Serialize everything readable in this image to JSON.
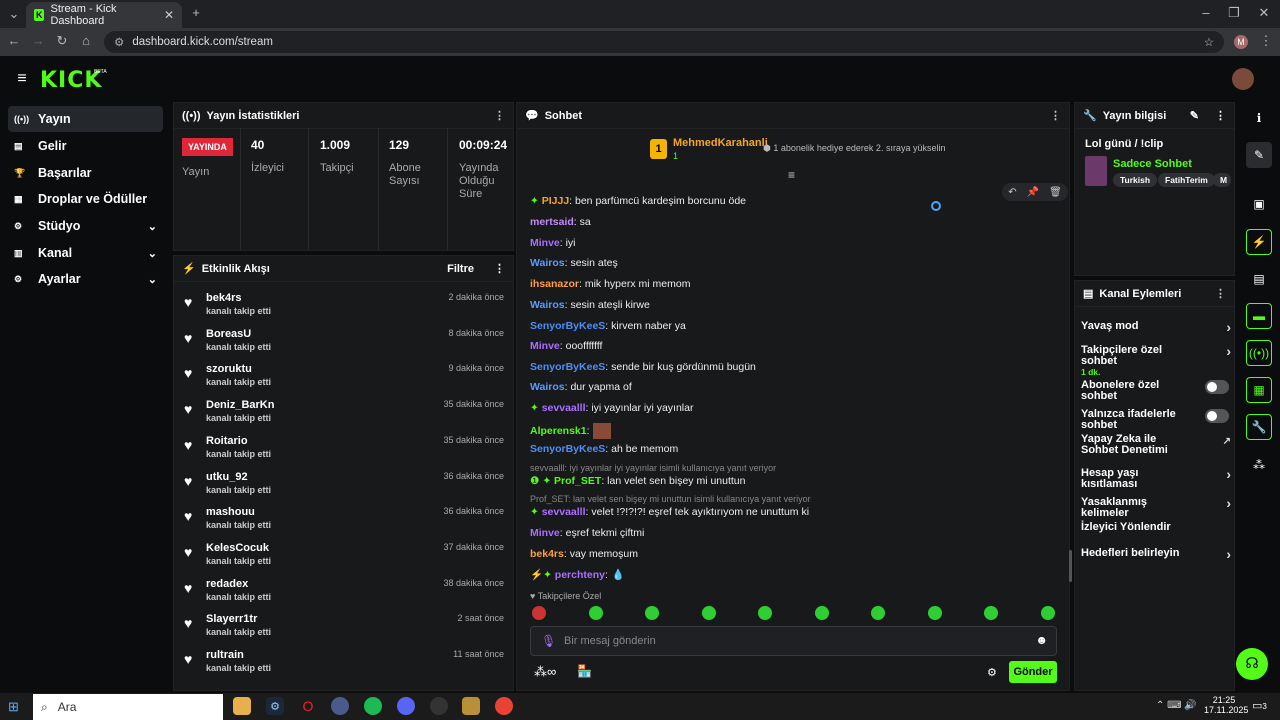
{
  "browser": {
    "tab_title": "Stream - Kick Dashboard",
    "url": "dashboard.kick.com/stream",
    "profile_initial": "M"
  },
  "app": {
    "logo": "KICK",
    "beta": "BETA"
  },
  "sidebar": {
    "items": [
      {
        "label": "Yayın",
        "icon": "stream-icon"
      },
      {
        "label": "Gelir",
        "icon": "income-icon"
      },
      {
        "label": "Başarılar",
        "icon": "trophy-icon"
      },
      {
        "label": "Droplar ve Ödüller",
        "icon": "gift-icon"
      },
      {
        "label": "Stüdyo",
        "icon": "gear-icon"
      },
      {
        "label": "Kanal",
        "icon": "channel-icon"
      },
      {
        "label": "Ayarlar",
        "icon": "settings-icon"
      }
    ]
  },
  "stats": {
    "title": "Yayın İstatistikleri",
    "live_badge": "YAYINDA",
    "live_label": "Yayın",
    "viewers": "40",
    "viewers_label": "İzleyici",
    "followers": "1.009",
    "followers_label": "Takipçi",
    "subs": "129",
    "subs_label": "Abone Sayısı",
    "uptime": "00:09:24",
    "uptime_label": "Yayında Olduğu Süre"
  },
  "activity": {
    "title": "Etkinlik Akışı",
    "filter": "Filtre",
    "events": [
      {
        "name": "bek4rs",
        "sub": "kanalı takip etti",
        "time": "2 dakika önce"
      },
      {
        "name": "BoreasU",
        "sub": "kanalı takip etti",
        "time": "8 dakika önce"
      },
      {
        "name": "szoruktu",
        "sub": "kanalı takip etti",
        "time": "9 dakika önce"
      },
      {
        "name": "Deniz_BarKn",
        "sub": "kanalı takip etti",
        "time": "35 dakika önce"
      },
      {
        "name": "Roitario",
        "sub": "kanalı takip etti",
        "time": "35 dakika önce"
      },
      {
        "name": "utku_92",
        "sub": "kanalı takip etti",
        "time": "36 dakika önce"
      },
      {
        "name": "mashouu",
        "sub": "kanalı takip etti",
        "time": "36 dakika önce"
      },
      {
        "name": "KelesCocuk",
        "sub": "kanalı takip etti",
        "time": "37 dakika önce"
      },
      {
        "name": "redadex",
        "sub": "kanalı takip etti",
        "time": "38 dakika önce"
      },
      {
        "name": "Slayerr1tr",
        "sub": "kanalı takip etti",
        "time": "2 saat önce"
      },
      {
        "name": "rultrain",
        "sub": "kanalı takip etti",
        "time": "11 saat önce"
      }
    ]
  },
  "chat": {
    "title": "Sohbet",
    "pinned_user": "MehmedKarahanli",
    "pinned_count": "1",
    "pinned_rank": "1",
    "gift_text": "1 abonelik hediye ederek 2. sıraya yükselin",
    "messages": [
      {
        "user": "PIJJJ",
        "color": "#f5a623",
        "text": ": ben parfümcü kardeşim borcunu öde"
      },
      {
        "user": "mertsaid",
        "color": "#c58af9",
        "text": ": sa"
      },
      {
        "user": "Minve",
        "color": "#a970ff",
        "text": ": iyi"
      },
      {
        "user": "Wairos",
        "color": "#5b9bff",
        "text": ": sesin ateş"
      },
      {
        "user": "ihsanazor",
        "color": "#ff9f43",
        "text": ": mik hyperx mi memom"
      },
      {
        "user": "Wairos",
        "color": "#5b9bff",
        "text": ": sesin ateşli kirwe"
      },
      {
        "user": "SenyorByKeeS",
        "color": "#4d8ef7",
        "text": ": kirvem naber ya"
      },
      {
        "user": "Minve",
        "color": "#a970ff",
        "text": ": ooofffffff"
      },
      {
        "user": "SenyorByKeeS",
        "color": "#4d8ef7",
        "text": ": sende bir kuş gördünmü bugün"
      },
      {
        "user": "Wairos",
        "color": "#5b9bff",
        "text": ": dur yapma of"
      },
      {
        "user": "sevvaalll",
        "color": "#a970ff",
        "text": ": iyi yayınlar iyi yayınlar"
      },
      {
        "user": "Alperensk1",
        "color": "#53fc18",
        "text": ":"
      },
      {
        "user": "SenyorByKeeS",
        "color": "#4d8ef7",
        "text": ": ah be memom"
      },
      {
        "user": "Prof_SET",
        "color": "#53fc18",
        "text": ": lan velet sen bişey mi unuttun"
      },
      {
        "user": "sevvaalll",
        "color": "#a970ff",
        "text": ": velet !?!?!?! eşref tek ayıktırıyom ne unuttum ki"
      },
      {
        "user": "Minve",
        "color": "#a970ff",
        "text": ": eşref tekmi çiftmi"
      },
      {
        "user": "bek4rs",
        "color": "#ff9f43",
        "text": ": vay memoşum"
      },
      {
        "user": "perchteny",
        "color": "#a970ff",
        "text": ":"
      }
    ],
    "reply1": "sevvaalll: iyi yayınlar iyi yayınlar isimli kullanıcıya yanıt veriyor",
    "reply2": "Prof_SET: lan velet sen bişey mi unuttun isimli kullanıcıya yanıt veriyor",
    "followers_only": "Takipçilere Özel",
    "placeholder": "Bir mesaj gönderin",
    "send": "Gönder"
  },
  "stream_info": {
    "title": "Yayın bilgisi",
    "stream_title": "Lol günü / !clip",
    "category": "Sadece Sohbet",
    "tags": [
      "Turkish",
      "FatihTerim",
      "M"
    ]
  },
  "channel_actions": {
    "title": "Kanal Eylemleri",
    "items": [
      {
        "label": "Yavaş mod",
        "type": "chev"
      },
      {
        "label": "Takipçilere özel sohbet",
        "sub": "1 dk.",
        "type": "chev"
      },
      {
        "label": "Abonelere özel sohbet",
        "type": "toggle"
      },
      {
        "label": "Yalnızca ifadelerle sohbet",
        "type": "toggle"
      },
      {
        "label": "Yapay Zeka ile Sohbet Denetimi",
        "type": "ext"
      },
      {
        "label": "Hesap yaşı kısıtlaması",
        "type": "chev"
      },
      {
        "label": "Yasaklanmış kelimeler",
        "type": "chev"
      },
      {
        "label": "İzleyici Yönlendir",
        "type": "none"
      },
      {
        "label": "Hedefleri belirleyin",
        "type": "chev"
      }
    ]
  },
  "taskbar": {
    "search": "Ara",
    "time": "21:25",
    "date": "17.11.2025",
    "notif": "3"
  }
}
